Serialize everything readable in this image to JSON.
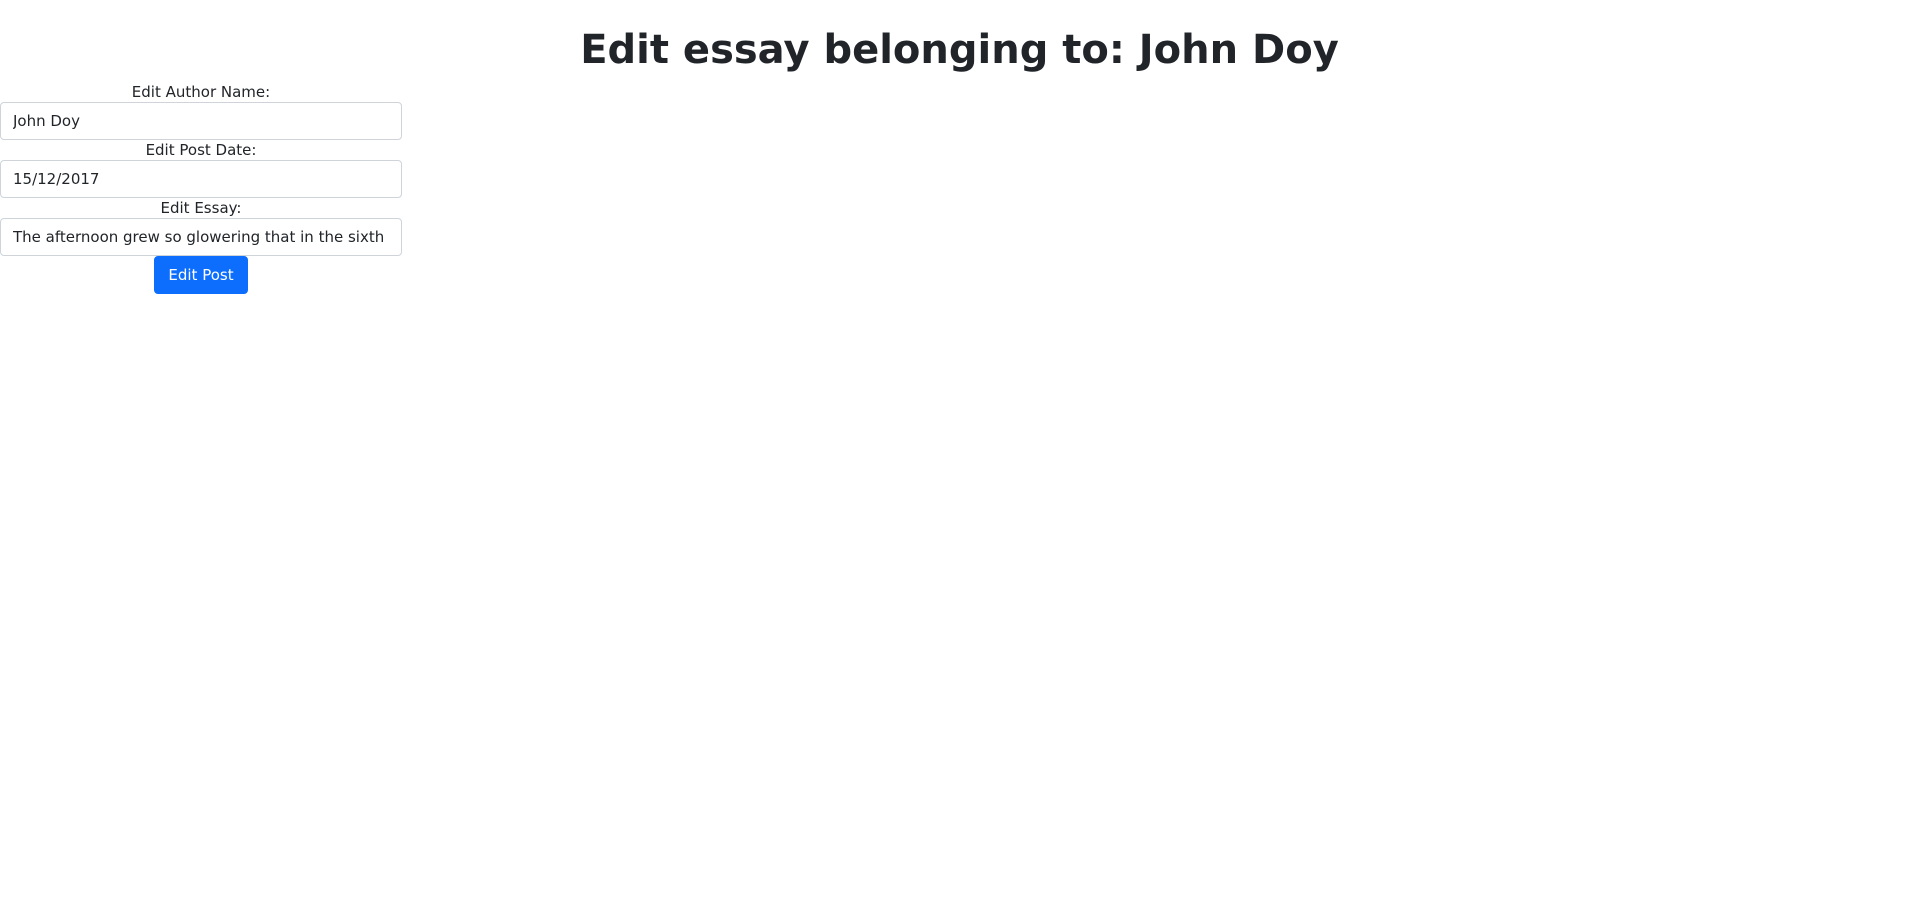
{
  "header": {
    "title": "Edit essay belonging to: John Doy"
  },
  "form": {
    "author": {
      "label": "Edit Author Name:",
      "value": "John Doy"
    },
    "date": {
      "label": "Edit Post Date:",
      "value": "15/12/2017"
    },
    "essay": {
      "label": "Edit Essay:",
      "value": "The afternoon grew so glowering that in the sixth inn"
    },
    "submit_label": "Edit Post"
  },
  "colors": {
    "primary": "#0d6efd",
    "text": "#212529",
    "border": "#ced4da"
  }
}
